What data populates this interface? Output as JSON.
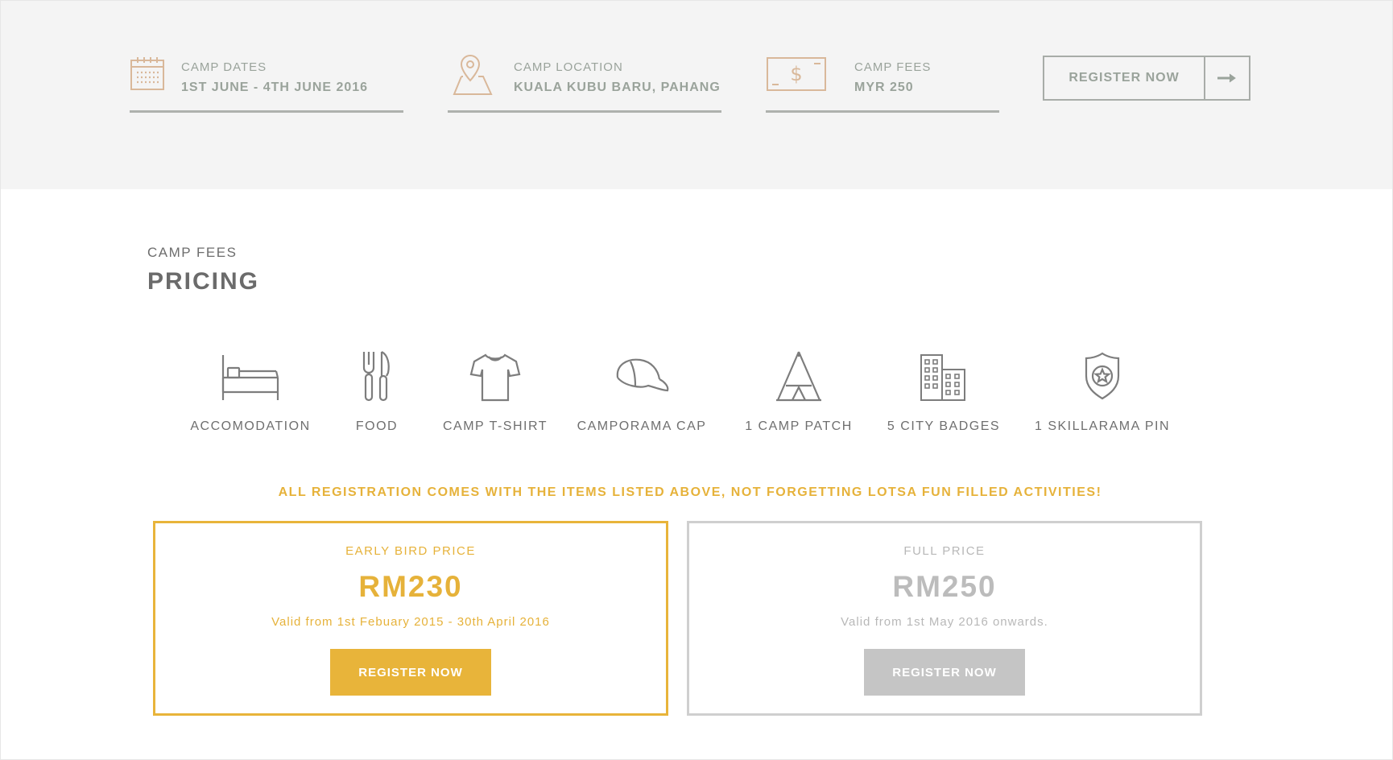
{
  "info_bar": {
    "dates": {
      "label": "CAMP DATES",
      "value": "1ST JUNE - 4TH JUNE 2016",
      "icon": "calendar-icon"
    },
    "location": {
      "label": "CAMP LOCATION",
      "value": "KUALA KUBU BARU, PAHANG",
      "icon": "map-pin-icon"
    },
    "fees": {
      "label": "CAMP FEES",
      "value": "MYR 250",
      "icon": "banknote-icon"
    },
    "register_label": "REGISTER NOW",
    "register_icon": "arrow-right-icon"
  },
  "section": {
    "subtitle": "CAMP FEES",
    "title": "PRICING"
  },
  "included_items": [
    {
      "label": "ACCOMODATION",
      "icon": "bed-icon"
    },
    {
      "label": "FOOD",
      "icon": "cutlery-icon"
    },
    {
      "label": "CAMP T-SHIRT",
      "icon": "tshirt-icon"
    },
    {
      "label": "CAMPORAMA CAP",
      "icon": "cap-icon"
    },
    {
      "label": "1 CAMP PATCH",
      "icon": "tent-icon"
    },
    {
      "label": "5 CITY BADGES",
      "icon": "buildings-icon"
    },
    {
      "label": "1 SKILLARAMA PIN",
      "icon": "badge-star-icon"
    }
  ],
  "note": "ALL REGISTRATION COMES WITH THE ITEMS LISTED ABOVE, NOT FORGETTING LOTSA FUN FILLED ACTIVITIES!",
  "pricing": {
    "early": {
      "type": "EARLY BIRD PRICE",
      "price": "RM230",
      "validity": "Valid from 1st Febuary 2015 - 30th April 2016",
      "button": "REGISTER NOW"
    },
    "full": {
      "type": "FULL PRICE",
      "price": "RM250",
      "validity": "Valid from 1st May 2016 onwards.",
      "button": "REGISTER NOW"
    }
  },
  "colors": {
    "accent": "#e8b43a",
    "muted": "#c5c5c5",
    "icon_tan": "#d9b89a",
    "info_text": "#9aa39b",
    "bar_bg": "#f4f4f4"
  }
}
